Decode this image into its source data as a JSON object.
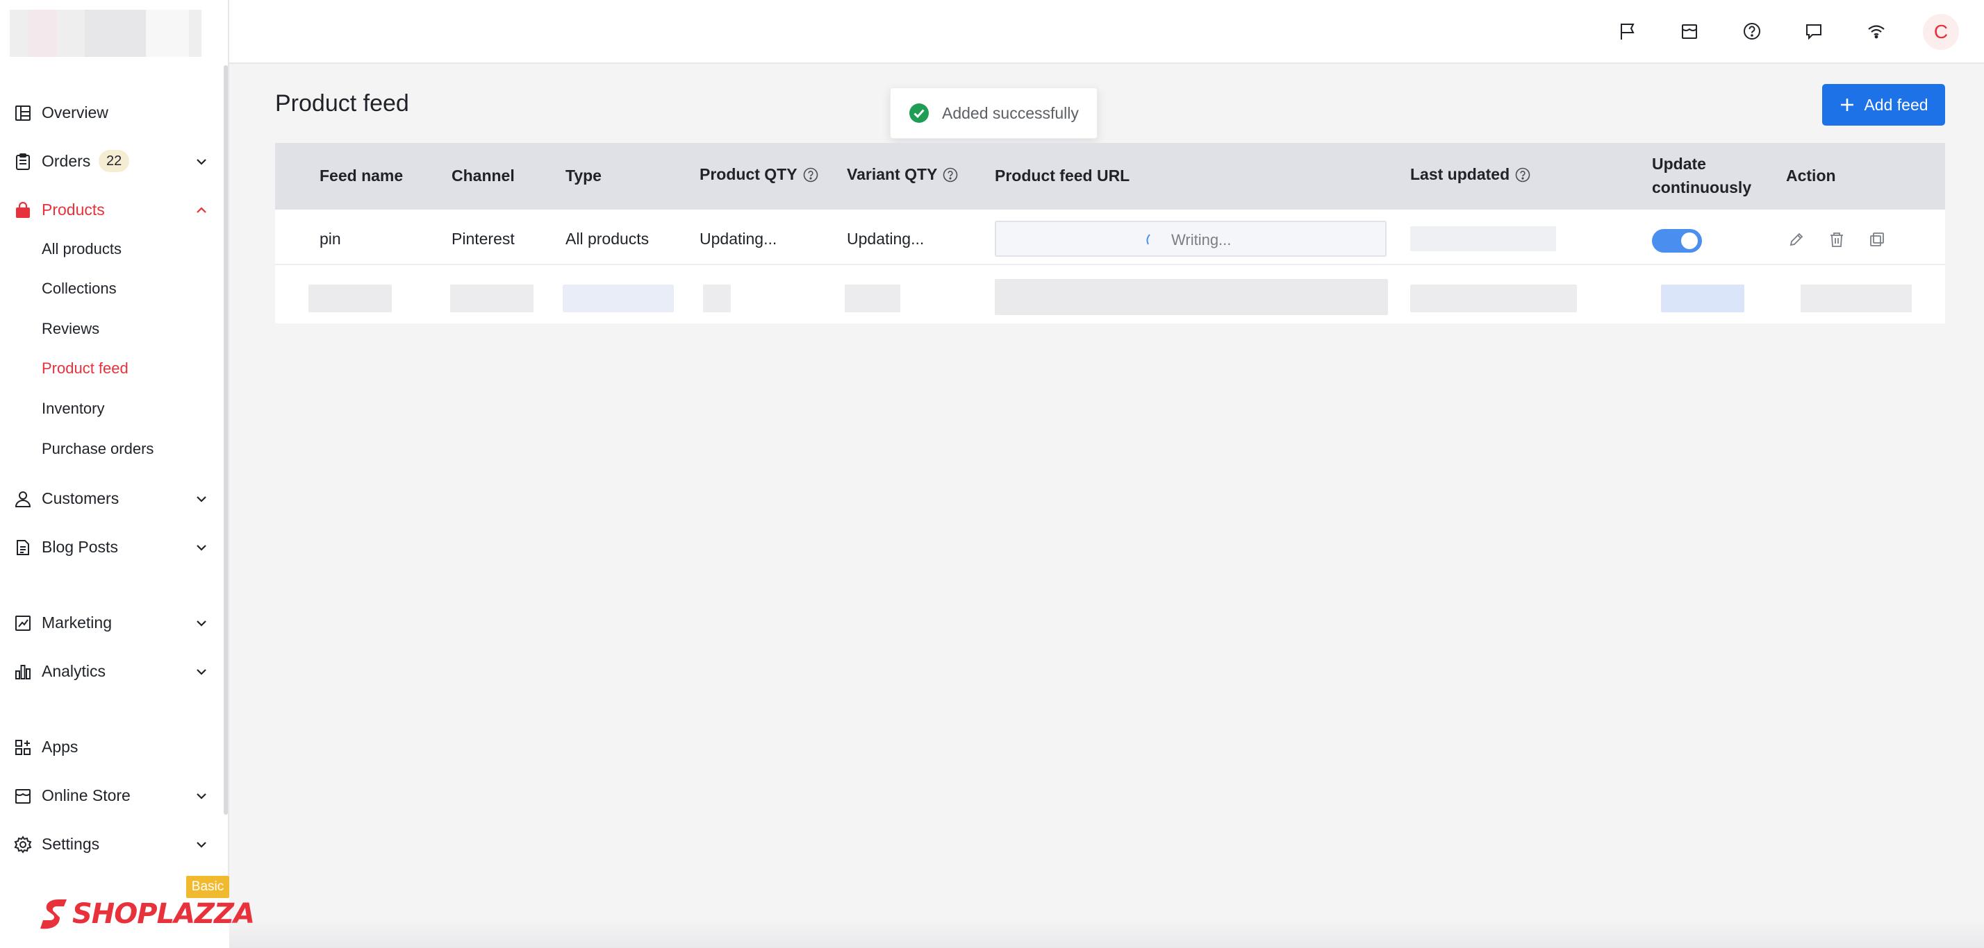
{
  "sidebar": {
    "items": [
      {
        "label": "Overview"
      },
      {
        "label": "Orders",
        "badge": "22"
      },
      {
        "label": "Products"
      },
      {
        "label": "Customers"
      },
      {
        "label": "Blog Posts"
      },
      {
        "label": "Marketing"
      },
      {
        "label": "Analytics"
      },
      {
        "label": "Apps"
      },
      {
        "label": "Online Store"
      },
      {
        "label": "Settings"
      }
    ],
    "products_sub": [
      {
        "label": "All products"
      },
      {
        "label": "Collections"
      },
      {
        "label": "Reviews"
      },
      {
        "label": "Product feed"
      },
      {
        "label": "Inventory"
      },
      {
        "label": "Purchase orders"
      }
    ],
    "plan_badge": "Basic",
    "brand": "SHOPLAZZA"
  },
  "topbar": {
    "avatar_initial": "C",
    "icons": [
      "flag-icon",
      "store-icon",
      "help-icon",
      "chat-icon",
      "wifi-icon"
    ]
  },
  "page": {
    "title": "Product feed",
    "add_button": "Add feed"
  },
  "toast": {
    "message": "Added successfully",
    "color": "#1f9d55"
  },
  "table": {
    "headers": {
      "feed_name": "Feed name",
      "channel": "Channel",
      "type": "Type",
      "product_qty": "Product QTY",
      "variant_qty": "Variant QTY",
      "url": "Product feed URL",
      "last_updated": "Last updated",
      "update_line1": "Update",
      "update_line2": "continuously",
      "action": "Action"
    },
    "rows": [
      {
        "feed_name": "pin",
        "channel": "Pinterest",
        "type": "All products",
        "product_qty": "Updating...",
        "variant_qty": "Updating...",
        "url_status": "Writing...",
        "update_continuously": true
      }
    ]
  },
  "colors": {
    "accent": "#1d72e8",
    "active_nav": "#e8323b",
    "toggle_on": "#4a8ef0",
    "header_bg": "#dfe1e6"
  }
}
